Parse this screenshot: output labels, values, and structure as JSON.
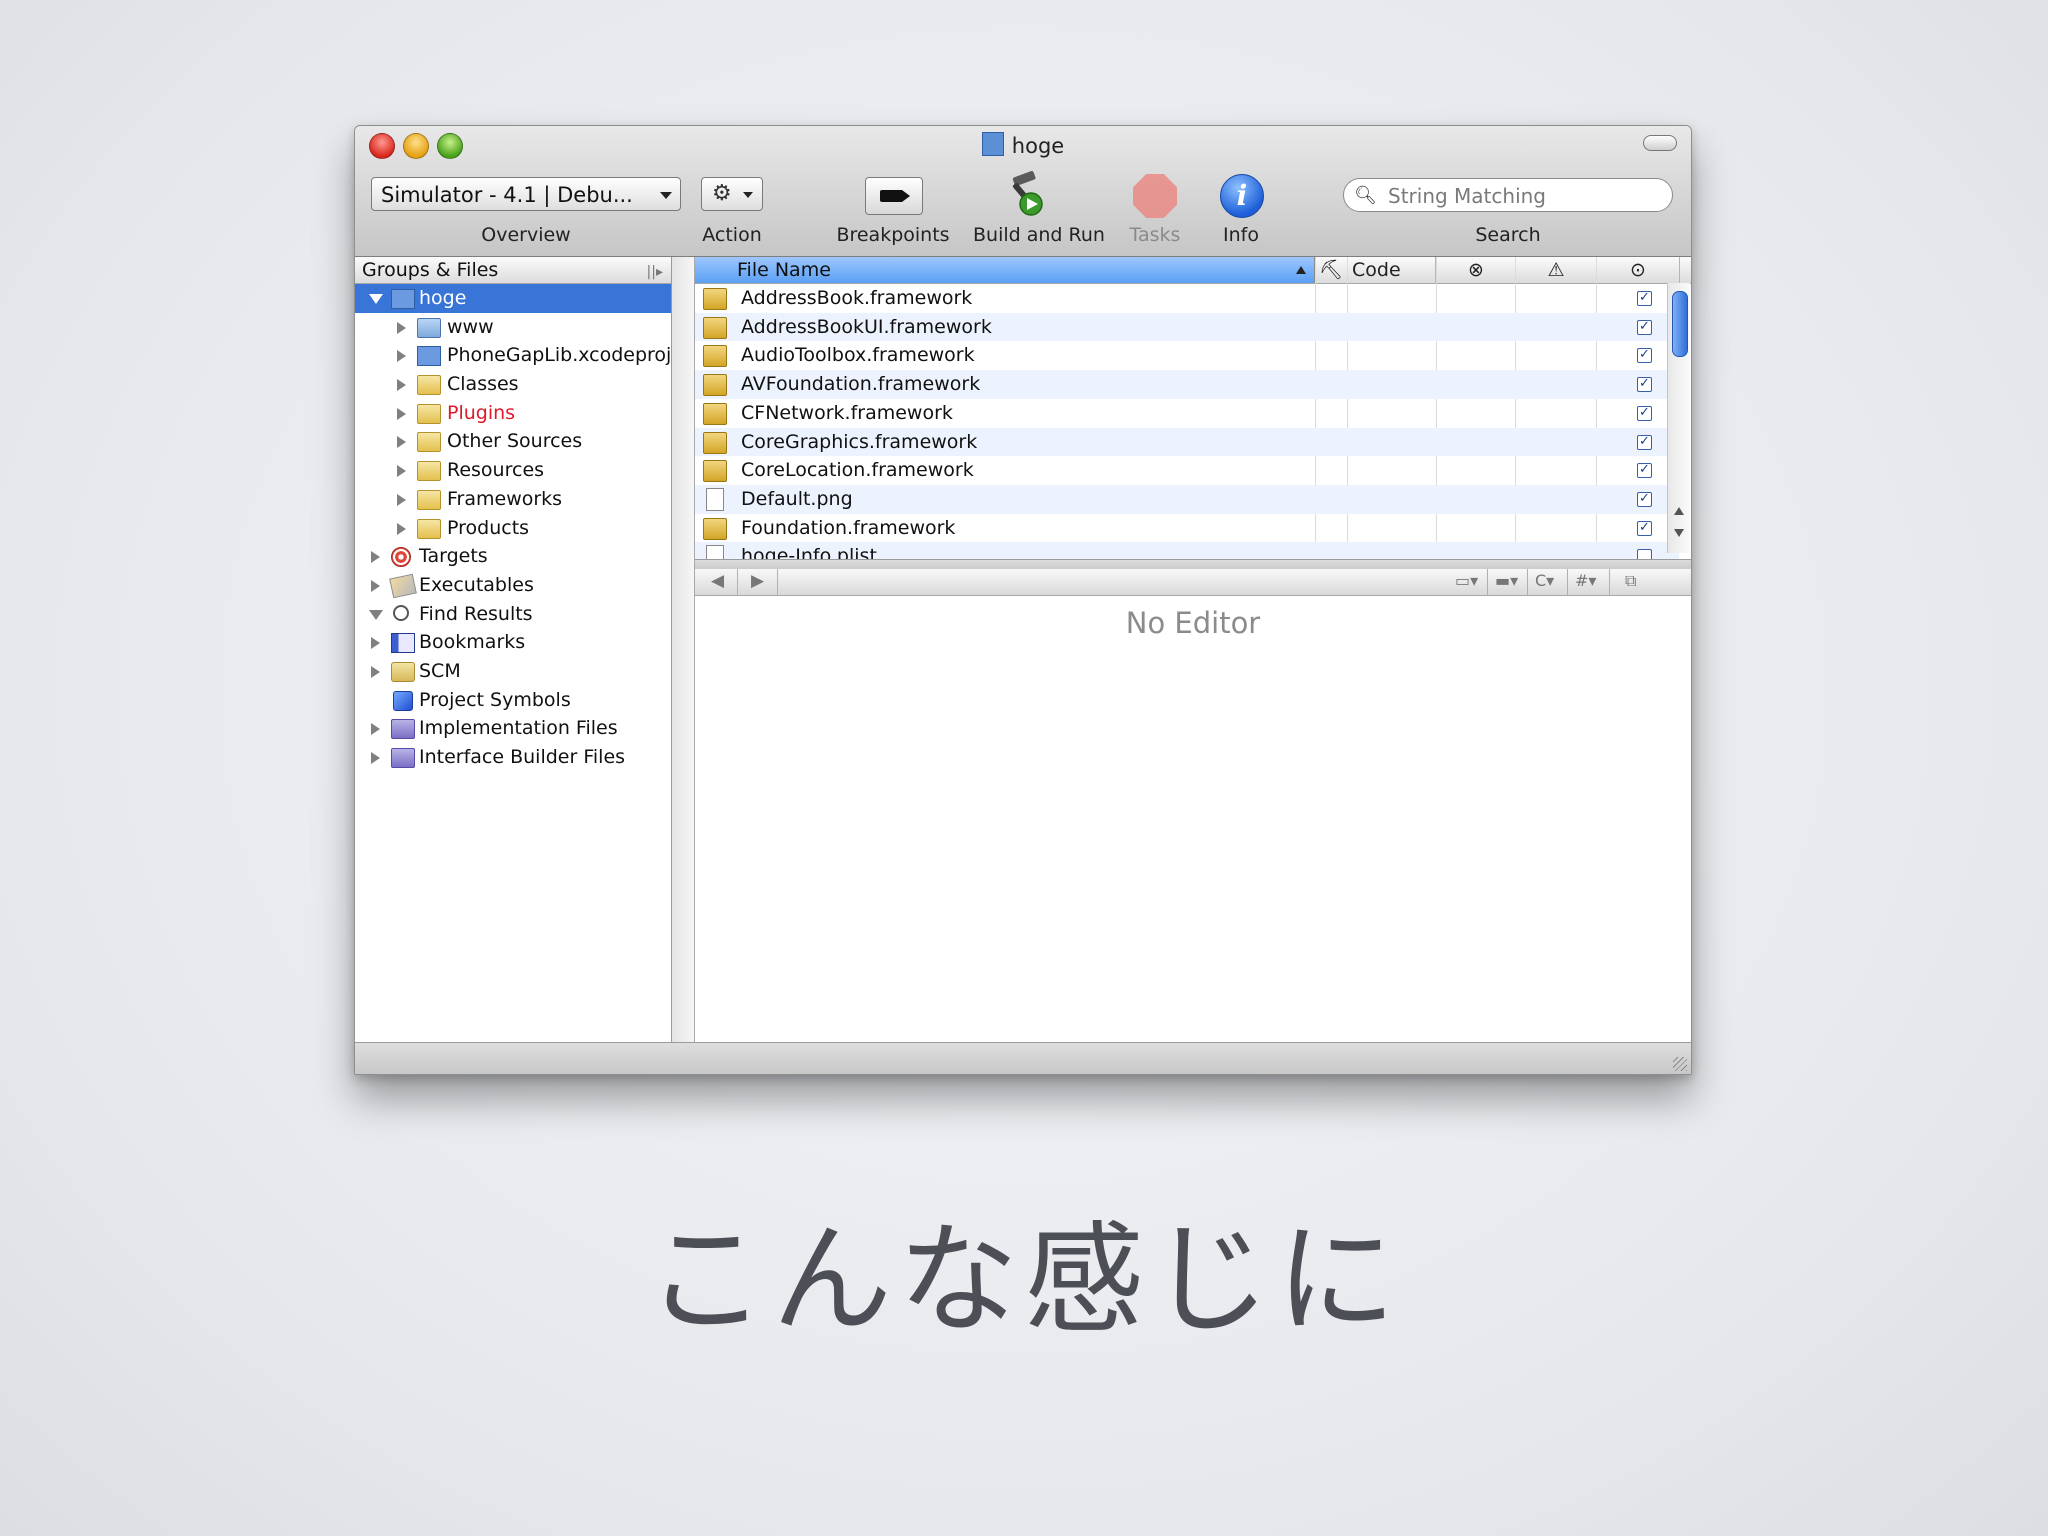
{
  "window": {
    "title": "hoge",
    "title_icon": "xcode-project-icon"
  },
  "toolbar": {
    "overview_value": "Simulator - 4.1 | Debu...",
    "overview_label": "Overview",
    "action_icon": "⚙",
    "action_label": "Action",
    "breakpoints_label": "Breakpoints",
    "build_run_label": "Build and Run",
    "tasks_label": "Tasks",
    "info_label": "Info",
    "search_placeholder": "String Matching",
    "search_label": "Search"
  },
  "sidebar": {
    "header": "Groups & Files",
    "items": [
      {
        "label": "hoge",
        "icon": "xcode-project-icon",
        "selected": true,
        "expanded": true
      },
      {
        "label": "www",
        "icon": "blue-folder-icon"
      },
      {
        "label": "PhoneGapLib.xcodeproj",
        "icon": "xcode-project-icon"
      },
      {
        "label": "Classes",
        "icon": "folder-icon"
      },
      {
        "label": "Plugins",
        "icon": "folder-icon",
        "color": "#e0182a"
      },
      {
        "label": "Other Sources",
        "icon": "folder-icon"
      },
      {
        "label": "Resources",
        "icon": "folder-icon"
      },
      {
        "label": "Frameworks",
        "icon": "folder-icon"
      },
      {
        "label": "Products",
        "icon": "folder-icon"
      },
      {
        "label": "Targets",
        "icon": "target-icon"
      },
      {
        "label": "Executables",
        "icon": "executable-icon"
      },
      {
        "label": "Find Results",
        "icon": "magnifier-icon"
      },
      {
        "label": "Bookmarks",
        "icon": "bookmark-icon"
      },
      {
        "label": "SCM",
        "icon": "scm-icon"
      },
      {
        "label": "Project Symbols",
        "icon": "cube-icon"
      },
      {
        "label": "Implementation Files",
        "icon": "smart-group-icon"
      },
      {
        "label": "Interface Builder Files",
        "icon": "smart-group-icon"
      }
    ]
  },
  "filelist": {
    "columns": {
      "file_name": "File Name",
      "build": "⛏",
      "code": "Code",
      "errors": "⊗",
      "warnings": "⚠",
      "target": "⊙"
    },
    "rows": [
      {
        "name": "AddressBook.framework",
        "icon": "framework-icon",
        "checked": true
      },
      {
        "name": "AddressBookUI.framework",
        "icon": "framework-icon",
        "checked": true
      },
      {
        "name": "AudioToolbox.framework",
        "icon": "framework-icon",
        "checked": true
      },
      {
        "name": "AVFoundation.framework",
        "icon": "framework-icon",
        "checked": true
      },
      {
        "name": "CFNetwork.framework",
        "icon": "framework-icon",
        "checked": true
      },
      {
        "name": "CoreGraphics.framework",
        "icon": "framework-icon",
        "checked": true
      },
      {
        "name": "CoreLocation.framework",
        "icon": "framework-icon",
        "checked": true
      },
      {
        "name": "Default.png",
        "icon": "image-file-icon",
        "checked": true
      },
      {
        "name": "Foundation.framework",
        "icon": "framework-icon",
        "checked": true
      },
      {
        "name": "hoge-Info.plist",
        "icon": "plist-file-icon",
        "checked": false
      }
    ]
  },
  "editor": {
    "nav_back": "◀",
    "nav_forward": "▶",
    "placeholder": "No Editor",
    "controls": [
      "C",
      "#"
    ]
  },
  "caption": "こんな感じに"
}
